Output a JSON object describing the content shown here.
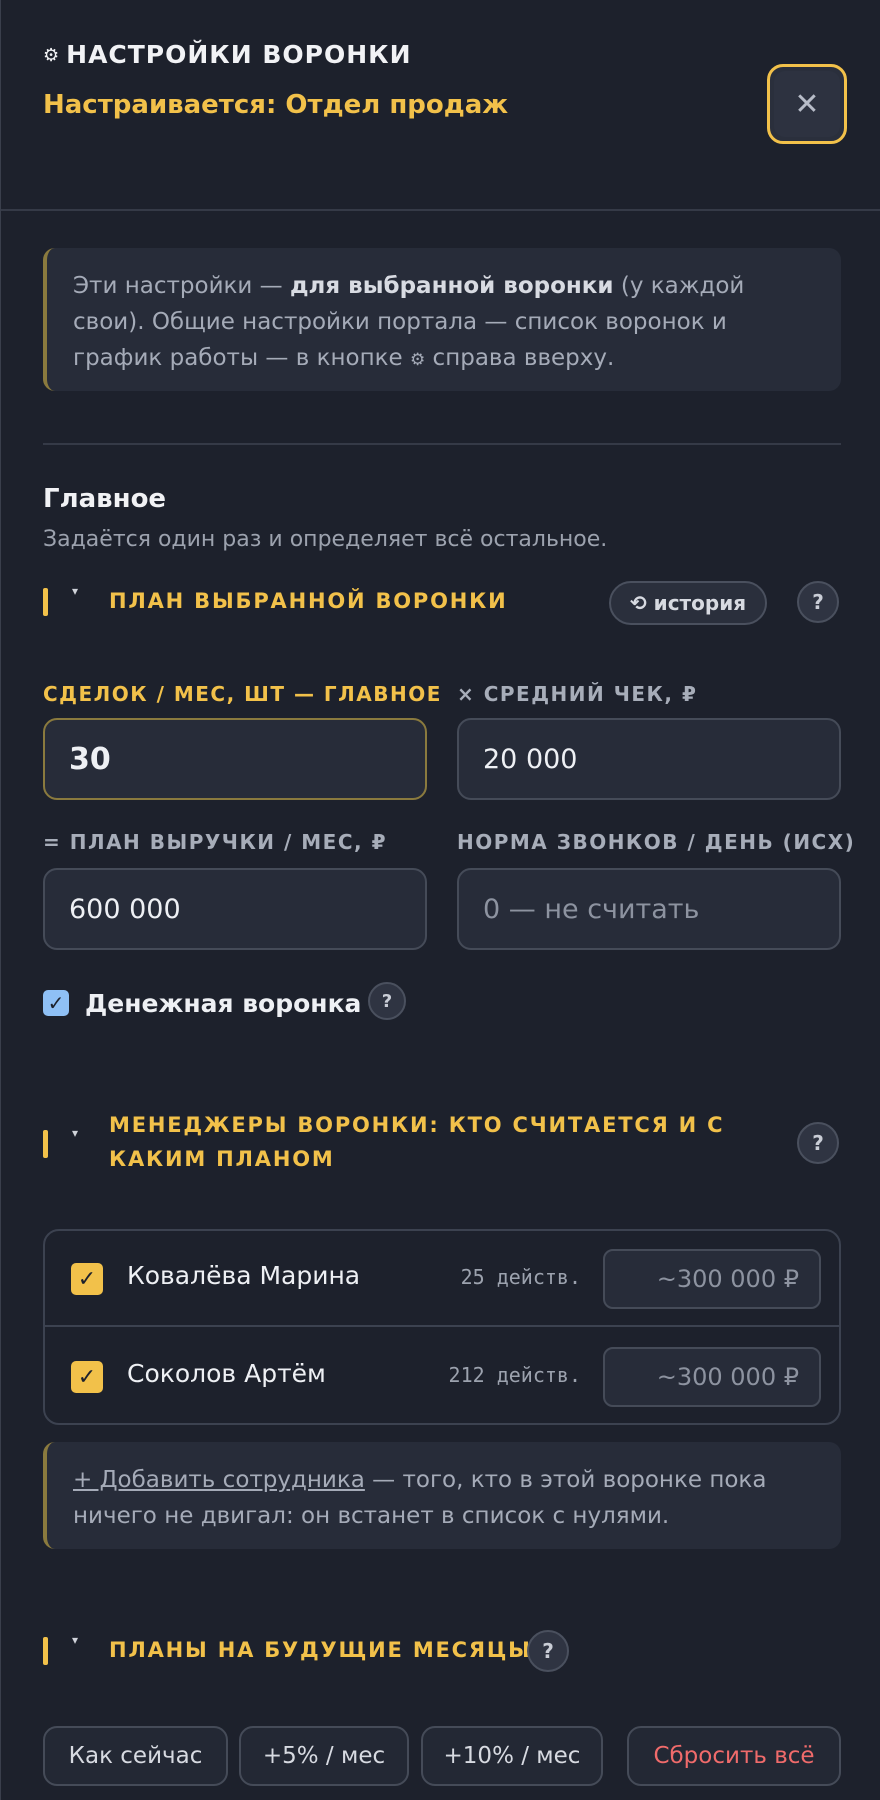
{
  "header": {
    "gear_icon": "⚙",
    "title": "НАСТРОЙКИ ВОРОНКИ",
    "subtitle": "Настраивается: Отдел продаж",
    "close_icon": "✕"
  },
  "info_note": {
    "part1": "Эти настройки — ",
    "part2_bold": "для выбранной воронки",
    "part3": " (у каждой свои). Общие настройки портала — список воронок и график работы — в кнопке ",
    "gear_icon": "⚙",
    "part4": " справа вверху."
  },
  "main_section": {
    "title": "Главное",
    "description": "Задаётся один раз и определяет всё остальное."
  },
  "plan_group": {
    "toggle_icon": "▾",
    "label": "ПЛАН ВЫБРАННОЙ ВОРОНКИ",
    "history_button": "⟲ история",
    "help": "?"
  },
  "fields": {
    "deals_label": "СДЕЛОК / МЕС, ШТ — ГЛАВНОЕ",
    "deals_value": "30",
    "avg_check_label": "× СРЕДНИЙ ЧЕК, ₽",
    "avg_check_value": "20 000",
    "revenue_label": "= ПЛАН ВЫРУЧКИ / МЕС, ₽",
    "revenue_value": "600 000",
    "calls_label": "НОРМА ЗВОНКОВ / ДЕНЬ (ИСХ)",
    "calls_placeholder": "0 — не считать"
  },
  "money_funnel": {
    "checked": true,
    "check_icon": "✓",
    "label": "Денежная воронка",
    "help": "?"
  },
  "managers_group": {
    "toggle_icon": "▾",
    "label_line1": "МЕНЕДЖЕРЫ ВОРОНКИ: КТО СЧИТАЕТСЯ И С",
    "label_line2": "КАКИМ ПЛАНОМ",
    "help": "?"
  },
  "managers": [
    {
      "name": "Ковалёва Марина",
      "actions": "25 действ.",
      "amount": "~300 000 ₽",
      "checked": true,
      "check_icon": "✓"
    },
    {
      "name": "Соколов Артём",
      "actions": "212 действ.",
      "amount": "~300 000 ₽",
      "checked": true,
      "check_icon": "✓"
    }
  ],
  "add_note": {
    "link": "+ Добавить сотрудника",
    "text": " — того, кто в этой воронке пока ничего не двигал: он встанет в список с нулями."
  },
  "future_group": {
    "toggle_icon": "▾",
    "label": "ПЛАНЫ НА БУДУЩИЕ МЕСЯЦЫ",
    "help": "?"
  },
  "future_buttons": {
    "as_now": "Как сейчас",
    "plus5": "+5% / мес",
    "plus10": "+10% / мес",
    "reset": "Сбросить всё"
  },
  "colors": {
    "accent": "#f2c14a",
    "background": "#1d212c",
    "danger": "#f06b6b",
    "checkbox_blue": "#8fc0f5"
  }
}
